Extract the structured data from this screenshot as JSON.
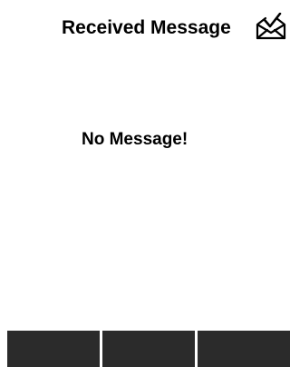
{
  "header": {
    "title": "Received Message",
    "icon": "envelope-check-icon"
  },
  "main": {
    "empty_text": "No Message!"
  },
  "softkeys": [
    {
      "label": ""
    },
    {
      "label": ""
    },
    {
      "label": ""
    }
  ],
  "colors": {
    "background": "#ffffff",
    "text": "#000000",
    "softkey": "#2b2b2b"
  }
}
